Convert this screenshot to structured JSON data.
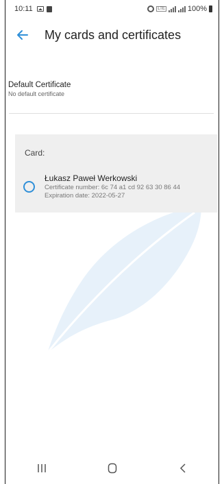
{
  "status_bar": {
    "time": "10:11",
    "battery": "100%",
    "network": "LTE"
  },
  "app_bar": {
    "title": "My cards and certificates",
    "back_icon": "arrow-back-icon"
  },
  "default_certificate": {
    "title": "Default Certificate",
    "value": "No default certificate"
  },
  "card": {
    "label": "Card:",
    "certificate": {
      "holder": "Łukasz Paweł Werkowski",
      "number_line": "Certificate number: 6c 74 a1 cd 92 63 30 86 44",
      "expiration_line": "Expiration date: 2022-05-27",
      "selected": false
    }
  },
  "nav_bar": {
    "recents_icon": "recents-icon",
    "home_icon": "home-icon",
    "back_icon": "back-icon"
  },
  "colors": {
    "accent": "#2f8fd8",
    "card_background": "#efefef",
    "watermark": "#e7f1fa"
  }
}
